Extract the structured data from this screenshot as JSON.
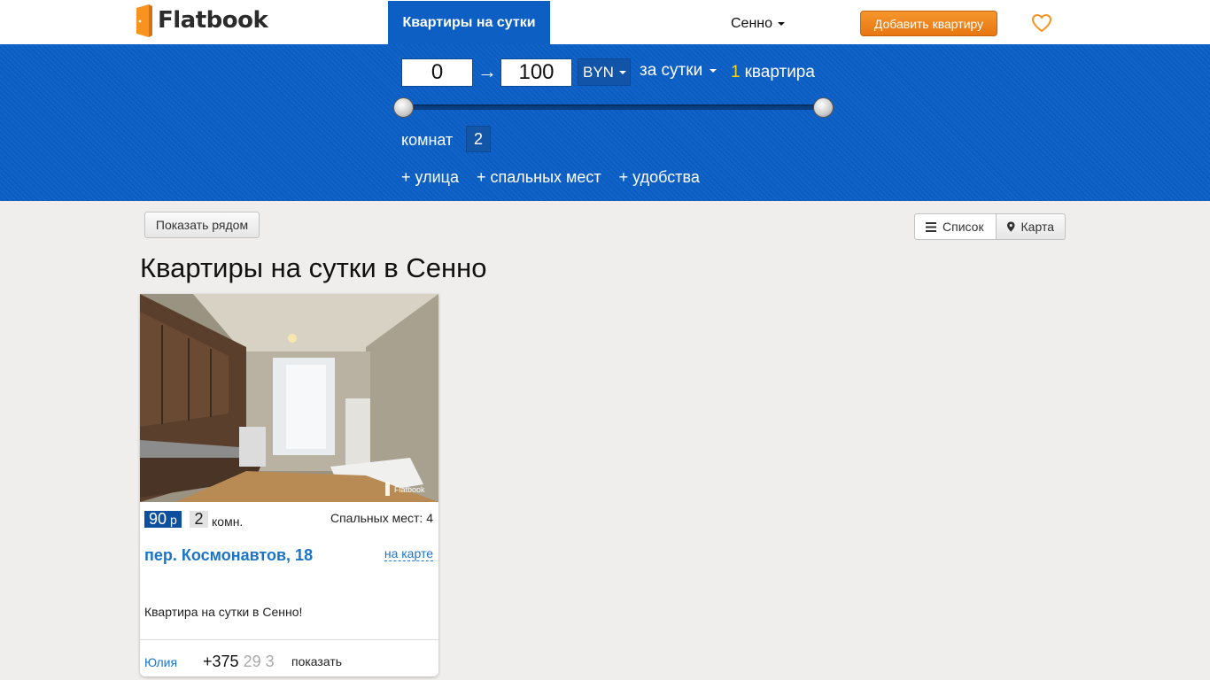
{
  "header": {
    "logo_text": "Flatbook",
    "nav_active": "Квартиры на сутки",
    "city": "Сенно",
    "add_button": "Добавить квартиру",
    "favorites_icon": "heart-icon"
  },
  "filters": {
    "price_min": "0",
    "price_max": "100",
    "arrow": "→",
    "currency": "BYN",
    "period": "за сутки",
    "result_count": "1",
    "result_label": "квартира",
    "price_slider_range": {
      "min_fraction": 0.0,
      "max_fraction": 1.0
    },
    "rooms_label": "комнат",
    "rooms_value": "2",
    "extra": [
      "+ улица",
      "+ спальных мест",
      "+ удобства"
    ],
    "colors": {
      "band": "#0a5fc6",
      "accent": "#ffd700"
    }
  },
  "toolbar": {
    "nearby_button": "Показать рядом",
    "list_button": "Список",
    "map_button": "Карта"
  },
  "page_title": "Квартиры на сутки в Сенно",
  "listing": {
    "price": "90",
    "price_currency": "р",
    "rooms": "2",
    "rooms_unit": "комн.",
    "beds": "Спальных мест: 4",
    "address": "пер. Космонавтов, 18",
    "map_link": "на карте",
    "description": "Квартира на сутки в Сенно!",
    "owner": "Юлия",
    "phone_visible": "+375",
    "phone_partial": "29 3",
    "show_phone": "показать",
    "photo_watermark": "Flatbook"
  }
}
